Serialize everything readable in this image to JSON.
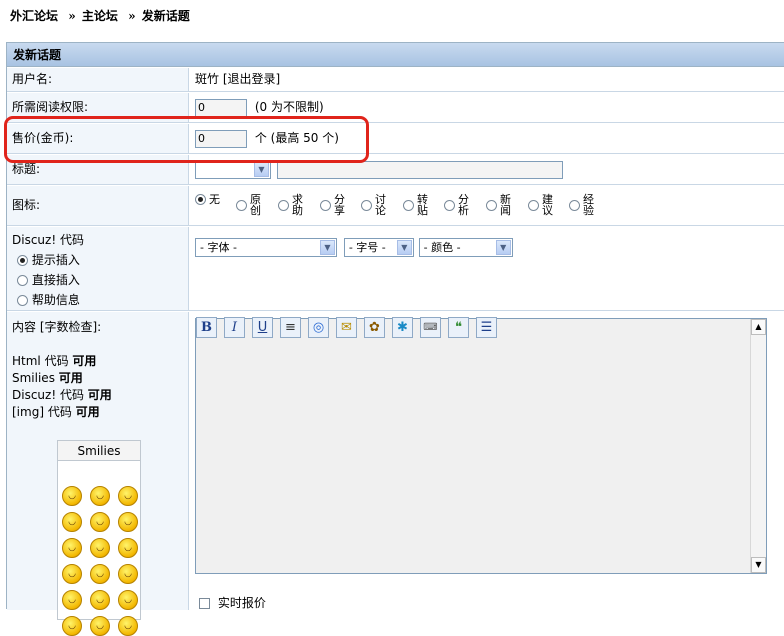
{
  "breadcrumb": {
    "forum": "外汇论坛",
    "main": "主论坛",
    "current": "发新话题",
    "sep": "»"
  },
  "panel": {
    "title": "发新话题"
  },
  "rows": {
    "username_label": "用户名:",
    "username_value": "斑竹",
    "logout": "[退出登录]",
    "readperm_label": "所需阅读权限:",
    "readperm_value": "0",
    "readperm_hint": "(0 为不限制)",
    "price_label": "售价(金币):",
    "price_value": "0",
    "price_hint": "个 (最高 50 个)",
    "subject_label": "标题:",
    "icon_label": "图标:"
  },
  "icons": [
    "无",
    "原创",
    "求助",
    "分享",
    "讨论",
    "转贴",
    "分析",
    "新闻",
    "建议",
    "经验"
  ],
  "discuz": {
    "title": "Discuz! 代码",
    "options": [
      "提示插入",
      "直接插入",
      "帮助信息"
    ]
  },
  "editor": {
    "font": "- 字体 -",
    "size": "- 字号 -",
    "color": "- 颜色 -",
    "buttons": [
      "bold-icon",
      "italic-icon",
      "underline-icon",
      "align-center-icon",
      "link-icon",
      "email-icon",
      "image-icon",
      "flash-icon",
      "code-icon",
      "quote-icon",
      "list-icon"
    ]
  },
  "content": {
    "label": "内容 [字数检查]:",
    "html_label": "Html 代码",
    "html_state": "可用",
    "smilies_label": "Smilies",
    "smilies_state": "可用",
    "discuz_label": "Discuz! 代码",
    "discuz_state": "可用",
    "img_label": "[img] 代码",
    "img_state": "可用",
    "smilies_title": "Smilies",
    "realtime": "实时报价"
  },
  "colors": {
    "highlight": "#e0241b",
    "header": "#a8c3e2",
    "label_bg": "#f1f6fb"
  }
}
